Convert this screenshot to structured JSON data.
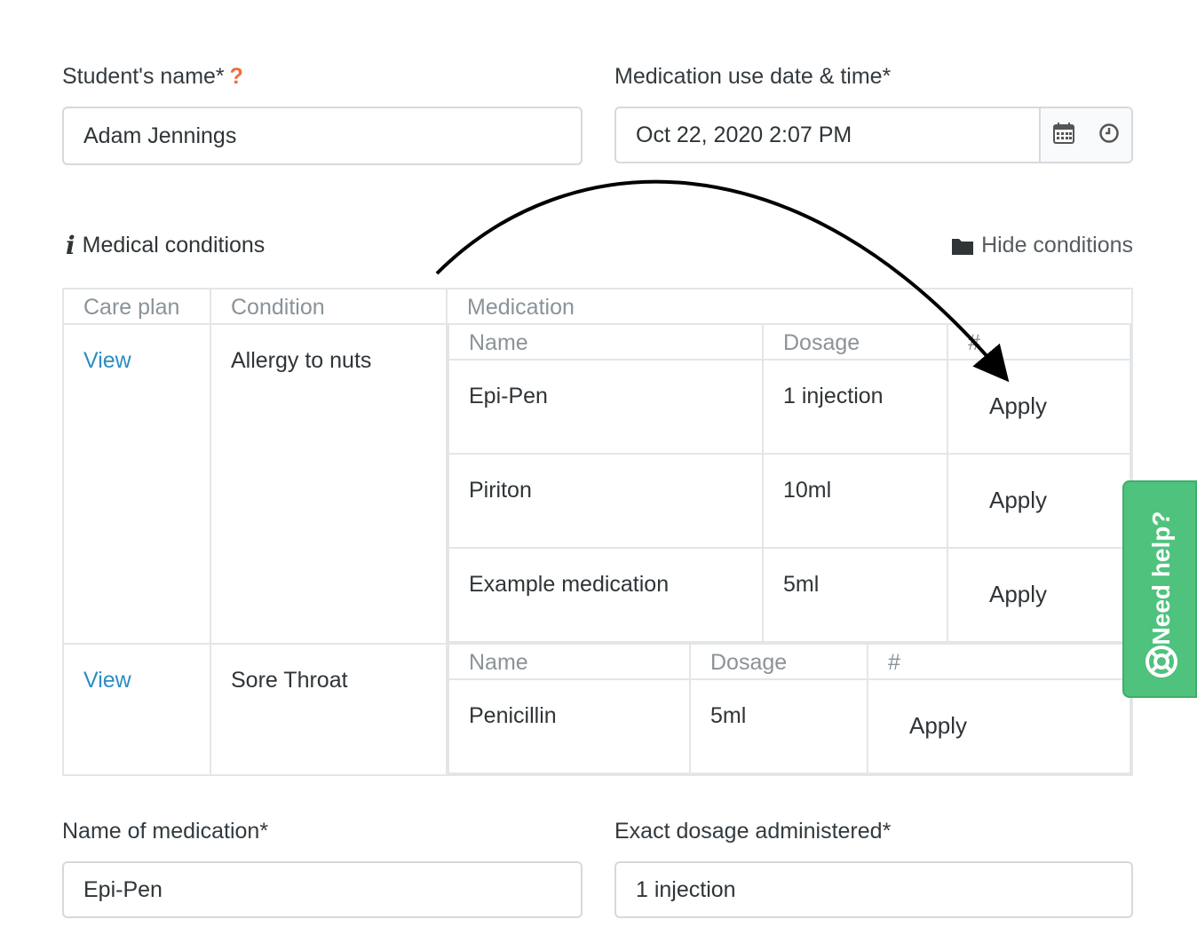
{
  "student": {
    "label": "Student's name*",
    "help_mark": "?",
    "value": "Adam Jennings"
  },
  "datetime": {
    "label": "Medication use date & time*",
    "value": "Oct 22, 2020 2:07 PM",
    "calendar_icon": "calendar-icon",
    "clock_icon": "clock-icon"
  },
  "conditions": {
    "title": "Medical conditions",
    "info_icon": "i",
    "hide_label": "Hide conditions",
    "hide_icon": "folder-icon",
    "headers": {
      "care_plan": "Care plan",
      "condition": "Condition",
      "medication": "Medication"
    },
    "rows": [
      {
        "care_plan_link": "View",
        "condition": "Allergy to nuts",
        "med_headers": {
          "name": "Name",
          "dosage": "Dosage",
          "hash": "#"
        },
        "medications": [
          {
            "name": "Epi-Pen",
            "dosage": "1 injection",
            "action": "Apply"
          },
          {
            "name": "Piriton",
            "dosage": "10ml",
            "action": "Apply"
          },
          {
            "name": "Example medication",
            "dosage": "5ml",
            "action": "Apply"
          }
        ]
      },
      {
        "care_plan_link": "View",
        "condition": "Sore Throat",
        "med_headers": {
          "name": "Name",
          "dosage": "Dosage",
          "hash": "#"
        },
        "medications": [
          {
            "name": "Penicillin",
            "dosage": "5ml",
            "action": "Apply"
          }
        ]
      }
    ]
  },
  "medication_name": {
    "label": "Name of medication*",
    "value": "Epi-Pen"
  },
  "dosage": {
    "label": "Exact dosage administered*",
    "value": "1 injection"
  },
  "help_widget": {
    "label": "Need help?",
    "icon": "lifebuoy-icon",
    "color": "#4fc27e"
  }
}
